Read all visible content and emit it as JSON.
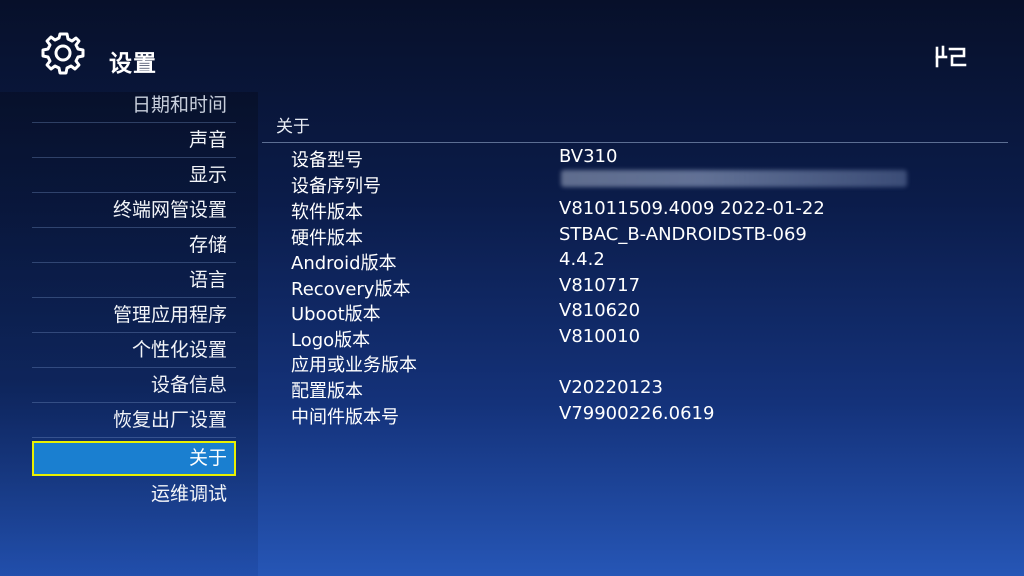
{
  "header": {
    "title": "设置",
    "settings_icon": "gear-icon",
    "brand_logo": "brand-logo"
  },
  "sidebar": {
    "items": [
      {
        "label": "日期和时间"
      },
      {
        "label": "声音"
      },
      {
        "label": "显示"
      },
      {
        "label": "终端网管设置"
      },
      {
        "label": "存储"
      },
      {
        "label": "语言"
      },
      {
        "label": "管理应用程序"
      },
      {
        "label": "个性化设置"
      },
      {
        "label": "设备信息"
      },
      {
        "label": "恢复出厂设置"
      },
      {
        "label": "关于"
      },
      {
        "label": "运维调试"
      }
    ],
    "selected": "关于"
  },
  "main": {
    "section_title": "关于",
    "rows": [
      {
        "label": "设备型号",
        "value": "BV310"
      },
      {
        "label": "设备序列号",
        "value": ""
      },
      {
        "label": "软件版本",
        "value": "V81011509.4009 2022-01-22"
      },
      {
        "label": "硬件版本",
        "value": "STBAC_B-ANDROIDSTB-069"
      },
      {
        "label": "Android版本",
        "value": "4.4.2"
      },
      {
        "label": "Recovery版本",
        "value": "V810717"
      },
      {
        "label": "Uboot版本",
        "value": "V810620"
      },
      {
        "label": "Logo版本",
        "value": "V810010"
      },
      {
        "label": "应用或业务版本",
        "value": ""
      },
      {
        "label": "配置版本",
        "value": "V20220123"
      },
      {
        "label": "中间件版本号",
        "value": "V79900226.0619"
      }
    ]
  },
  "colors": {
    "selection_fill": "#1a7fd0",
    "selection_border": "#e9f000"
  }
}
